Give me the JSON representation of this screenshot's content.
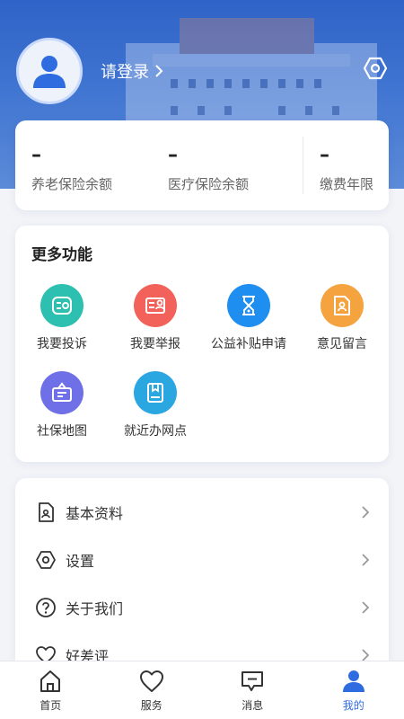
{
  "header": {
    "login_text": "请登录",
    "avatar_icon": "user-avatar-icon",
    "settings_icon": "hexagon-settings-icon"
  },
  "stats": [
    {
      "value": "–",
      "label": "养老保险余额"
    },
    {
      "value": "–",
      "label": "医疗保险余额"
    },
    {
      "value": "–",
      "label": "缴费年限"
    }
  ],
  "more": {
    "title": "更多功能",
    "items": [
      {
        "label": "我要投诉",
        "icon": "complaint-icon",
        "color": "#2dbfb0"
      },
      {
        "label": "我要举报",
        "icon": "report-icon",
        "color": "#f2625b"
      },
      {
        "label": "公益补贴申请",
        "icon": "hourglass-icon",
        "color": "#1e8ff0"
      },
      {
        "label": "意见留言",
        "icon": "feedback-doc-icon",
        "color": "#f5a33e"
      },
      {
        "label": "社保地图",
        "icon": "map-card-icon",
        "color": "#6f6fe8"
      },
      {
        "label": "就近办网点",
        "icon": "book-icon",
        "color": "#2aa6e0"
      }
    ]
  },
  "menu": [
    {
      "label": "基本资料",
      "icon": "profile-doc-icon"
    },
    {
      "label": "设置",
      "icon": "hexagon-settings-icon"
    },
    {
      "label": "关于我们",
      "icon": "question-circle-icon"
    },
    {
      "label": "好差评",
      "icon": "heart-icon"
    }
  ],
  "tabbar": {
    "tabs": [
      {
        "label": "首页",
        "icon": "home-icon"
      },
      {
        "label": "服务",
        "icon": "heart-icon"
      },
      {
        "label": "消息",
        "icon": "message-icon"
      },
      {
        "label": "我的",
        "icon": "person-icon"
      }
    ],
    "active_color": "#2f6ce0"
  }
}
